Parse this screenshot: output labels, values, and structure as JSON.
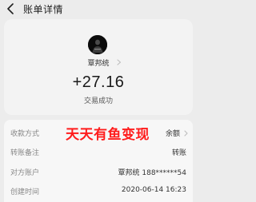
{
  "header": {
    "title": "账单详情"
  },
  "summary": {
    "nickname": "覃邦统",
    "amount": "+27.16",
    "status": "交易成功"
  },
  "details": [
    {
      "label": "收款方式",
      "value": "余额"
    },
    {
      "label": "转账备注",
      "value": "转账"
    },
    {
      "label": "对方账户",
      "value": "覃邦统 188******54"
    },
    {
      "label": "创建时间",
      "value": "2020-06-14 16:23"
    }
  ],
  "overlay_text": "天天有鱼变现",
  "icons": {
    "back": "chevron-left-icon",
    "nickname_more": "chevron-right-icon",
    "row_more": "chevron-right-icon"
  },
  "colors": {
    "overlay": "#ff1c1c",
    "background": "#ececec"
  }
}
